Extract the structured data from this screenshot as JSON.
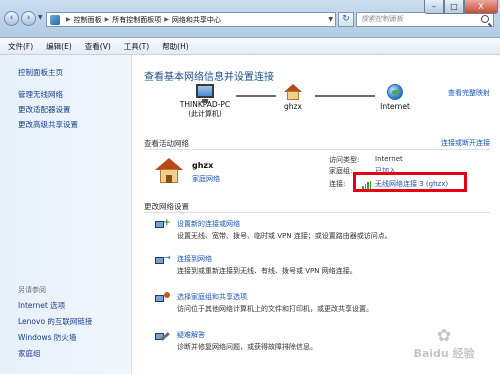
{
  "titlebar": {
    "breadcrumbs": [
      "控制面板",
      "所有控制面板项",
      "网络和共享中心"
    ],
    "search_placeholder": "搜索控制面板",
    "window_controls": {
      "minimize": "–",
      "maximize": "□",
      "close": "X"
    },
    "nav": {
      "back": "‹",
      "forward": "›",
      "refresh": "↻"
    }
  },
  "menubar": {
    "items": [
      "文件(F)",
      "编辑(E)",
      "查看(V)",
      "工具(T)",
      "帮助(H)"
    ]
  },
  "sidebar": {
    "home": "控制面板主页",
    "links": [
      "管理无线网络",
      "更改适配器设置",
      "更改高级共享设置"
    ],
    "see_also_title": "另请参阅",
    "see_also": [
      "Internet 选项",
      "Lenovo 的互联网链接",
      "Windows 防火墙",
      "家庭组"
    ]
  },
  "main": {
    "title": "查看基本网络信息并设置连接",
    "view_full_map": "查看完整映射",
    "network_map": {
      "computer": "THINKPAD-PC",
      "computer_sub": "(此计算机)",
      "network": "ghzx",
      "internet": "Internet"
    },
    "active_networks": {
      "heading": "查看活动网络",
      "connect_link": "连接或断开连接",
      "name": "ghzx",
      "type": "家庭网络",
      "access_label": "访问类型:",
      "access_value": "Internet",
      "homegroup_label": "家庭组:",
      "homegroup_value": "已加入",
      "connection_label": "连接:",
      "connection_value": "无线网络连接 3 (ghzx)"
    },
    "settings": {
      "heading": "更改网络设置",
      "tasks": [
        {
          "link": "设置新的连接或网络",
          "desc": "设置无线、宽带、拨号、临时或 VPN 连接；或设置路由器或访问点。"
        },
        {
          "link": "连接到网络",
          "desc": "连接到或重新连接到无线、有线、拨号或 VPN 网络连接。"
        },
        {
          "link": "选择家庭组和共享选项",
          "desc": "访问位于其他网络计算机上的文件和打印机，或更改共享设置。"
        },
        {
          "link": "疑难解答",
          "desc": "诊断并修复网络问题，或获得故障排除信息。"
        }
      ]
    }
  },
  "watermark": {
    "symbol": "✿",
    "text": "Baidu 经验"
  },
  "colors": {
    "link": "#1a56b3",
    "title": "#1d4e8f",
    "highlight": "#e60012",
    "signal": "#35a23a"
  }
}
